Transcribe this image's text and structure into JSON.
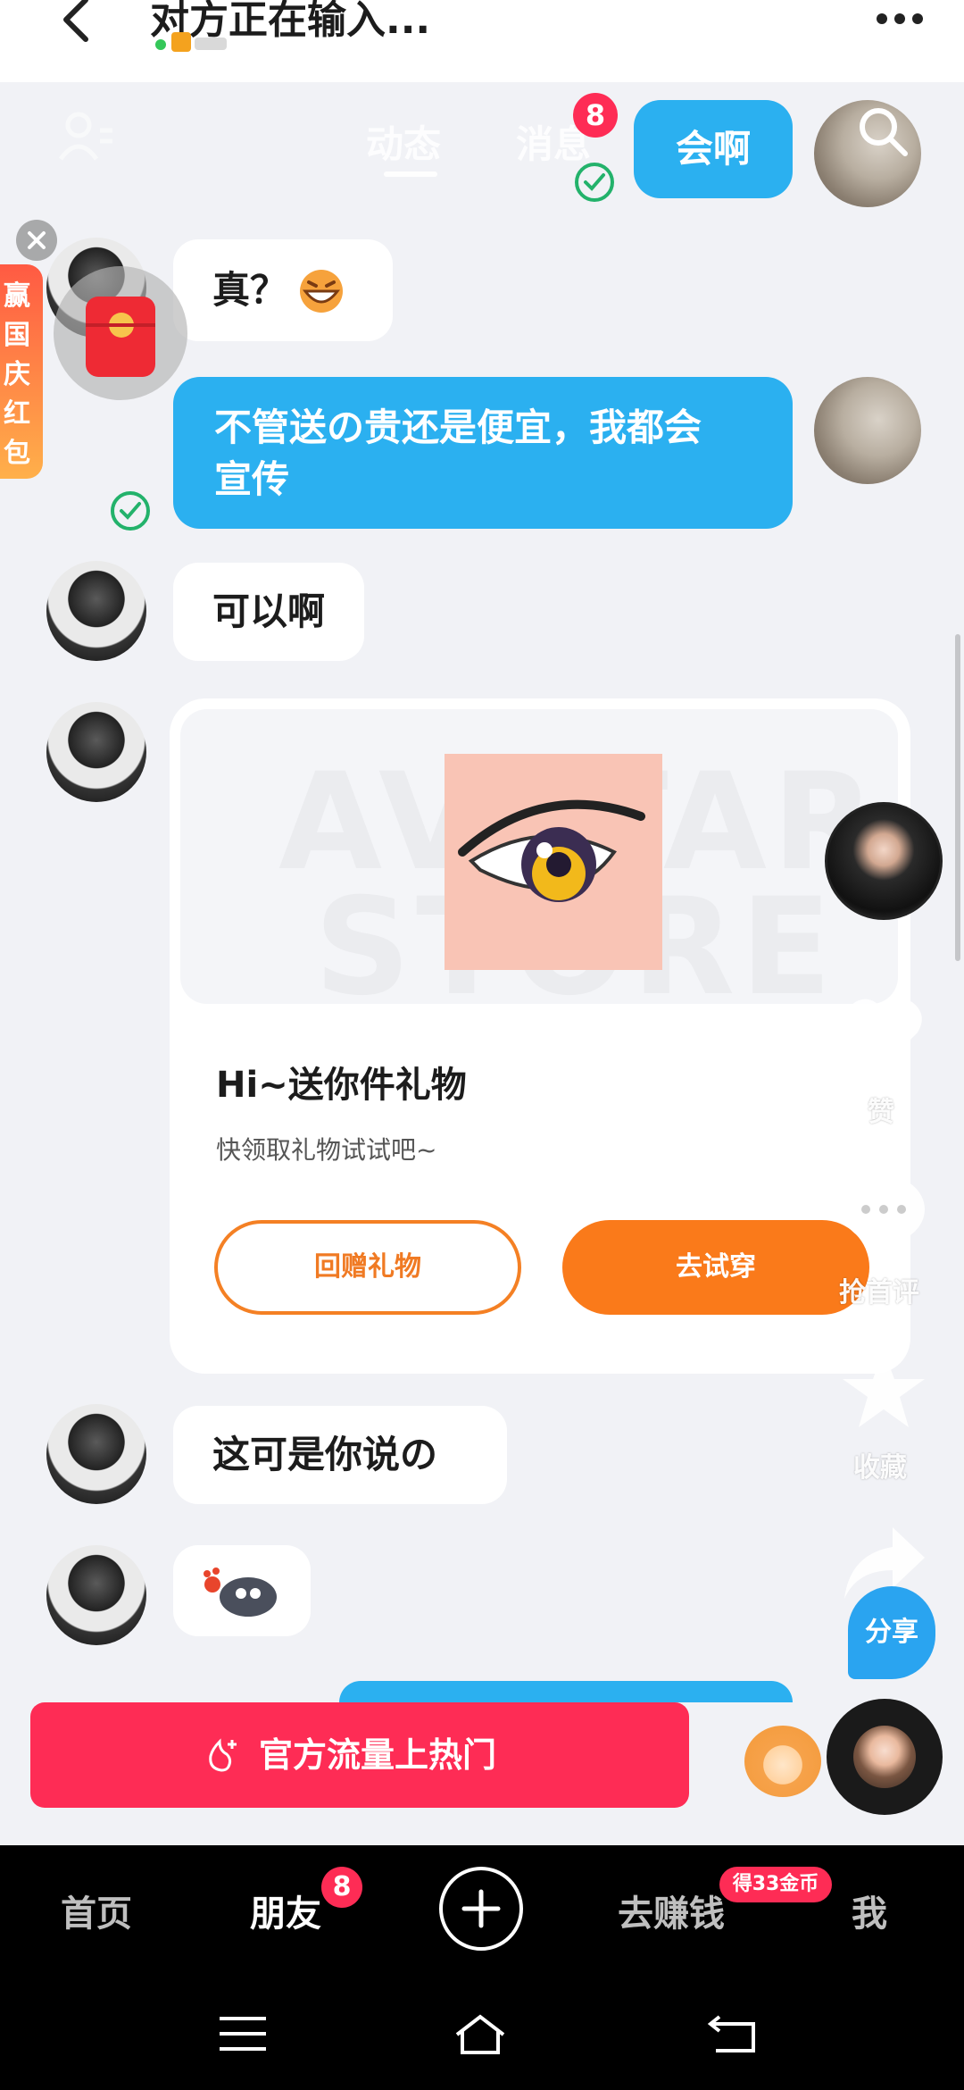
{
  "header": {
    "title": "对方正在输入...",
    "back_icon": "chevron-left-icon",
    "more_icon": "more-icon"
  },
  "feed_nav": {
    "tabs": [
      "动态",
      "消息"
    ],
    "badge": "8"
  },
  "messages": [
    {
      "side": "sent",
      "text": "会啊"
    },
    {
      "side": "received",
      "text": "真？"
    },
    {
      "side": "sent",
      "text_line1": "不管送の贵还是便宜，我都会",
      "text_line2": "宣传"
    },
    {
      "side": "received",
      "text": "可以啊"
    },
    {
      "side": "received",
      "text": "这可是你说の"
    }
  ],
  "gift_card": {
    "watermark_top": "AVATAR",
    "watermark_bottom": "STORE",
    "title": "Hi~送你件礼物",
    "subtitle": "快领取礼物试试吧~",
    "return_button": "回赠礼物",
    "try_button": "去试穿"
  },
  "side_actions": {
    "like": "赞",
    "comment": "抢首评",
    "favorite": "收藏",
    "share": "分享"
  },
  "promo": {
    "strip_chars": [
      "赢",
      "国",
      "庆",
      "红",
      "包"
    ]
  },
  "cta_button": "官方流量上热门",
  "bottom_nav": {
    "home": "首页",
    "friends": "朋友",
    "friends_badge": "8",
    "earn": "去赚钱",
    "earn_badge": "得33金币",
    "me": "我"
  },
  "colors": {
    "sent_bubble": "#2bb0f0",
    "cta": "#fe2c55",
    "gift_orange": "#fa7a1a"
  }
}
